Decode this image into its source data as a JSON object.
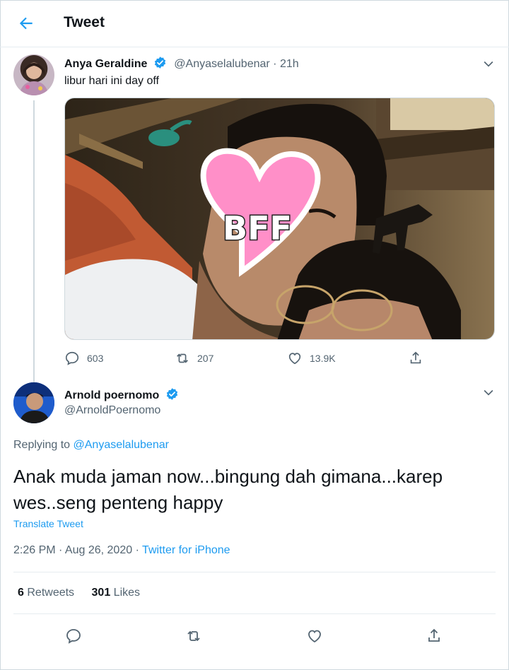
{
  "header": {
    "title": "Tweet",
    "back_icon": "back-arrow-icon"
  },
  "tweet1": {
    "name": "Anya Geraldine",
    "handle": "@Anyaselalubenar",
    "time": "· 21h",
    "text": "libur hari ini day off",
    "sticker_text": "BFF",
    "counts": {
      "replies": "603",
      "retweets": "207",
      "likes": "13.9K"
    }
  },
  "tweet2": {
    "name": "Arnold poernomo",
    "handle": "@ArnoldPoernomo",
    "replying_prefix": "Replying to ",
    "replying_to": "@Anyaselalubenar",
    "text": "Anak muda jaman now...bingung dah gimana...karep wes..seng penteng happy",
    "translate": "Translate Tweet",
    "date": "2:26 PM · Aug 26, 2020 · ",
    "source": "Twitter for iPhone",
    "retweets_count": "6",
    "retweets_label": "Retweets",
    "likes_count": "301",
    "likes_label": "Likes"
  },
  "colors": {
    "accent": "#1d9bf0",
    "muted": "#536471",
    "heart_sticker": "#ff8fc8"
  }
}
